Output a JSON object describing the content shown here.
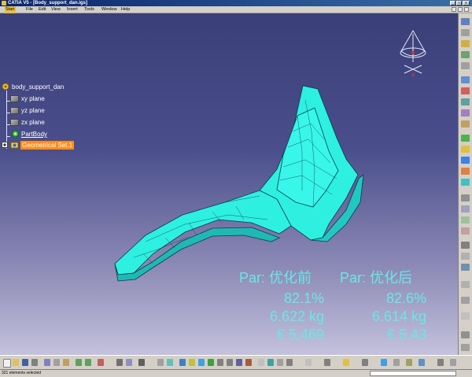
{
  "window": {
    "title": "CATIA V5 - [Body_support_dan.igs]",
    "min_label": "_",
    "max_label": "□",
    "close_label": "x"
  },
  "menu": {
    "items": [
      "Start",
      "File",
      "Edit",
      "View",
      "Insert",
      "Tools",
      "Window",
      "Help"
    ]
  },
  "tree": {
    "root": "body_support_dan",
    "planes": [
      "xy plane",
      "yz plane",
      "zx plane"
    ],
    "part_body": "PartBody",
    "geometrical_set": "Geometrical Set.1"
  },
  "overlay": {
    "col1_header": "Par: 优化前",
    "col2_header": "Par: 优化后",
    "col1_values": [
      "82.1%",
      "6.622 kg",
      "€ 5.469"
    ],
    "col2_values": [
      "82.6%",
      "6.614 kg",
      "€ 5.43"
    ]
  },
  "status": {
    "message": "321 elements selected"
  },
  "colors": {
    "part": "#2ef0e0",
    "overlay_text": "#67e8e8",
    "background_top": "#3a3f78",
    "background_bottom": "#c4c2dc",
    "selection": "#ff8c1a"
  }
}
